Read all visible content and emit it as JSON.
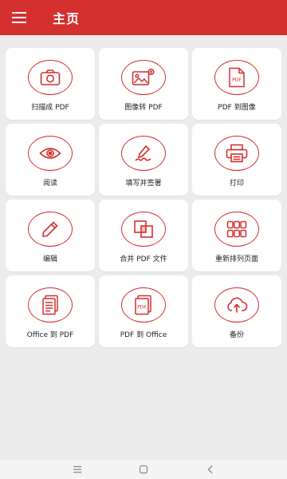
{
  "app_bar": {
    "title": "主页",
    "menu_icon": "hamburger-menu-icon"
  },
  "tiles": [
    {
      "id": "scan",
      "label": "扫描成 PDF",
      "icon": "camera-icon"
    },
    {
      "id": "image-to-pdf",
      "label": "图像转 PDF",
      "icon": "image-add-icon"
    },
    {
      "id": "pdf-to-image",
      "label": "PDF 到图像",
      "icon": "pdf-file-icon"
    },
    {
      "id": "read",
      "label": "阅读",
      "icon": "eye-icon"
    },
    {
      "id": "fill-sign",
      "label": "填写并签署",
      "icon": "pen-signature-icon"
    },
    {
      "id": "print",
      "label": "打印",
      "icon": "printer-icon"
    },
    {
      "id": "edit",
      "label": "编辑",
      "icon": "pencil-icon"
    },
    {
      "id": "merge",
      "label": "合并 PDF 文件",
      "icon": "merge-icon"
    },
    {
      "id": "reorder",
      "label": "重新排列页面",
      "icon": "grid-icon"
    },
    {
      "id": "office-to-pdf",
      "label": "Office 到 PDF",
      "icon": "document-icon"
    },
    {
      "id": "pdf-to-office",
      "label": "PDF 到 Office",
      "icon": "pdf-document-icon"
    },
    {
      "id": "backup",
      "label": "备份",
      "icon": "cloud-upload-icon"
    }
  ],
  "colors": {
    "accent": "#d32f2f",
    "background": "#ebebeb",
    "card": "#ffffff"
  },
  "system_nav": {
    "icons": [
      "recents-icon",
      "home-icon",
      "back-icon"
    ]
  }
}
